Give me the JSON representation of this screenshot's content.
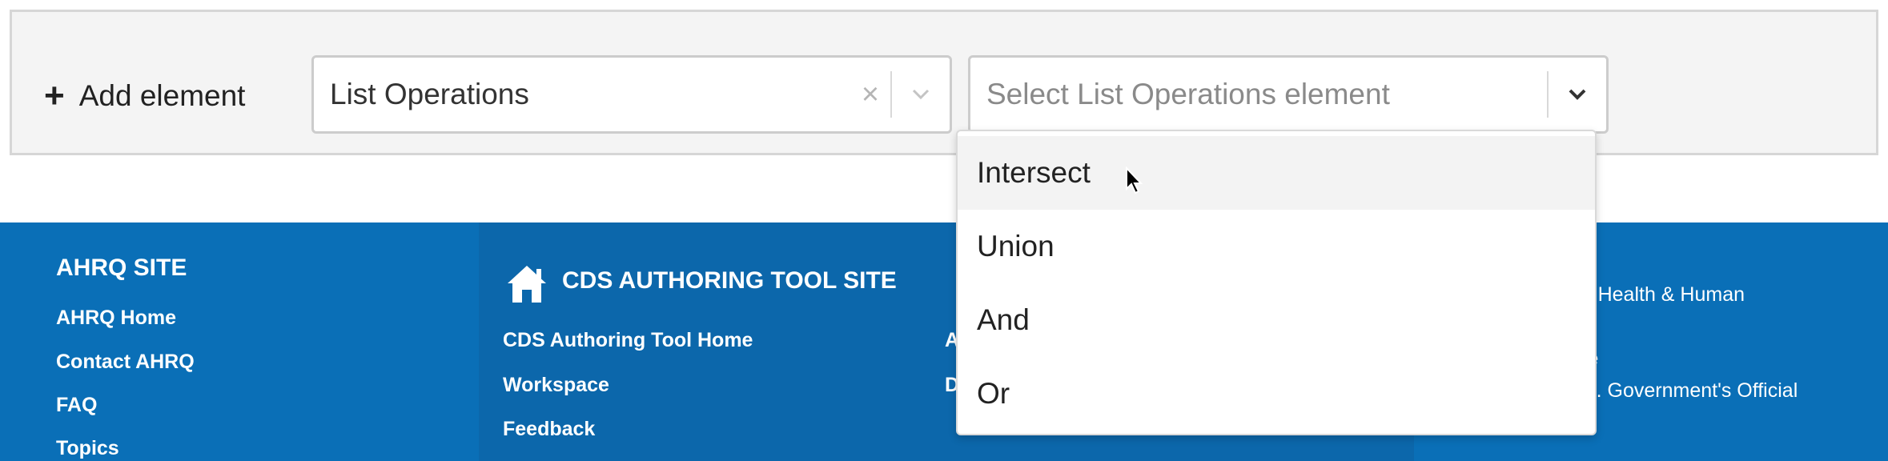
{
  "add_element": {
    "label": "Add element",
    "type_select": {
      "value": "List Operations"
    },
    "element_select": {
      "placeholder": "Select List Operations element",
      "options": [
        "Intersect",
        "Union",
        "And",
        "Or"
      ],
      "highlighted": "Intersect"
    }
  },
  "footer": {
    "ahrq": {
      "heading": "AHRQ SITE",
      "links": [
        "AHRQ Home",
        "Contact AHRQ",
        "FAQ",
        "Topics"
      ]
    },
    "cds": {
      "heading": "CDS AUTHORING TOOL SITE",
      "icon": "home-icon",
      "links": [
        "CDS Authoring Tool Home",
        "Workspace",
        "Feedback"
      ],
      "second_column_visible": [
        "A",
        "D"
      ]
    },
    "right_visible": [
      "nt of Health & Human",
      "se",
      ".S. Government's Official"
    ]
  },
  "colors": {
    "footer_bg": "#0a6fb7",
    "footer_mid_bg": "#0c67ab",
    "panel_bg": "#f4f4f4"
  }
}
